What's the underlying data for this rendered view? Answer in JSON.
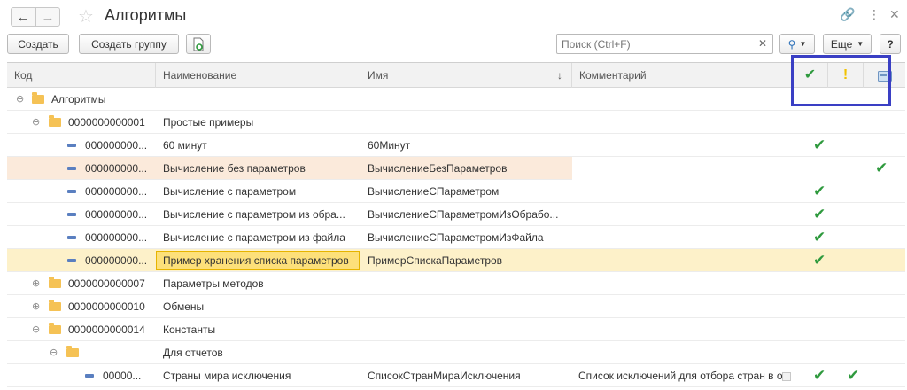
{
  "window": {
    "title": "Алгоритмы"
  },
  "toolbar": {
    "create_label": "Создать",
    "create_group_label": "Создать группу",
    "search_placeholder": "Поиск (Ctrl+F)",
    "more_label": "Еще",
    "help_label": "?"
  },
  "columns": {
    "code": "Код",
    "name": "Наименование",
    "id_name": "Имя",
    "comment": "Комментарий"
  },
  "icons": {
    "back": "arrow-left-icon",
    "forward": "arrow-right-icon",
    "favorite": "star-icon",
    "link": "link-icon",
    "menu": "vertical-dots-icon",
    "close": "close-icon",
    "search": "search-icon",
    "check_column": "check-icon",
    "warning_column": "exclamation-icon",
    "card_column": "card-icon"
  },
  "colors": {
    "check": "#2f9a3e",
    "warning": "#f2c200",
    "highlight_frame": "#3a3fc4",
    "folder": "#f5c255"
  },
  "rows": [
    {
      "code": "Алгоритмы",
      "name": "",
      "id_name": "",
      "comment": ""
    },
    {
      "code": "0000000000001",
      "name": "Простые примеры",
      "id_name": "",
      "comment": ""
    },
    {
      "code": "000000000...",
      "name": "60 минут",
      "id_name": "60Минут",
      "comment": ""
    },
    {
      "code": "000000000...",
      "name": "Вычисление без параметров",
      "id_name": "ВычислениеБезПараметров",
      "comment": ""
    },
    {
      "code": "000000000...",
      "name": "Вычисление с параметром",
      "id_name": "ВычислениеСПараметром",
      "comment": ""
    },
    {
      "code": "000000000...",
      "name": "Вычисление с параметром из обра...",
      "id_name": "ВычислениеСПараметромИзОбрабо...",
      "comment": ""
    },
    {
      "code": "000000000...",
      "name": "Вычисление с параметром из файла",
      "id_name": "ВычислениеСПараметромИзФайла",
      "comment": ""
    },
    {
      "code": "000000000...",
      "name": "Пример хранения списка параметров",
      "id_name": "ПримерСпискаПараметров",
      "comment": ""
    },
    {
      "code": "0000000000007",
      "name": "Параметры методов",
      "id_name": "",
      "comment": ""
    },
    {
      "code": "0000000000010",
      "name": "Обмены",
      "id_name": "",
      "comment": ""
    },
    {
      "code": "0000000000014",
      "name": "Константы",
      "id_name": "",
      "comment": ""
    },
    {
      "code": "",
      "name": "Для отчетов",
      "id_name": "",
      "comment": ""
    },
    {
      "code": "00000...",
      "name": "Страны мира исключения",
      "id_name": "СписокСтранМираИсключения",
      "comment": "Список исключений для отбора стран в о..."
    }
  ]
}
